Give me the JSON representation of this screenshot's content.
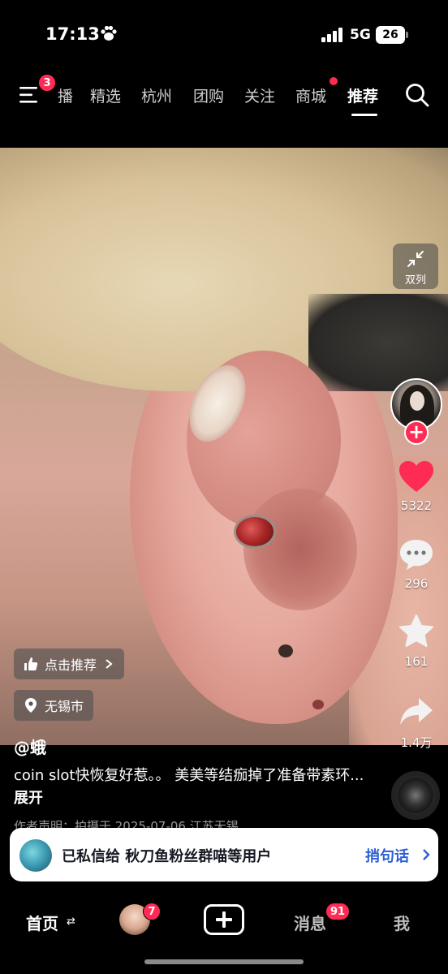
{
  "status_bar": {
    "time": "17:13",
    "network": "5G",
    "battery": "26"
  },
  "top_nav": {
    "menu_badge": "3",
    "tabs": [
      {
        "label": "播"
      },
      {
        "label": "精选"
      },
      {
        "label": "杭州"
      },
      {
        "label": "团购"
      },
      {
        "label": "关注"
      },
      {
        "label": "商城"
      },
      {
        "label": "推荐"
      }
    ],
    "active_tab": "推荐"
  },
  "sidebar": {
    "dual_label": "双列",
    "like_count": "5322",
    "comment_count": "296",
    "favorite_count": "161",
    "share_count": "1.4万"
  },
  "video_info": {
    "recommend_chip": "点击推荐",
    "location": "无锡市",
    "author": "@蛾",
    "caption": "coin slot快恢复好惹。。 美美等结痂掉了准备带素环...",
    "expand": "展开",
    "declaration": "作者声明：拍摄于 2025-07-06 江苏无锡"
  },
  "banner": {
    "text": "已私信给 秋刀鱼粉丝群喵等用户",
    "action": "捎句话"
  },
  "tab_bar": {
    "home": "首页",
    "friend_badge": "7",
    "messages": "消息",
    "messages_badge": "91",
    "me": "我"
  },
  "colors": {
    "accent": "#fe2c55",
    "banner_action": "#2c5fd6"
  }
}
